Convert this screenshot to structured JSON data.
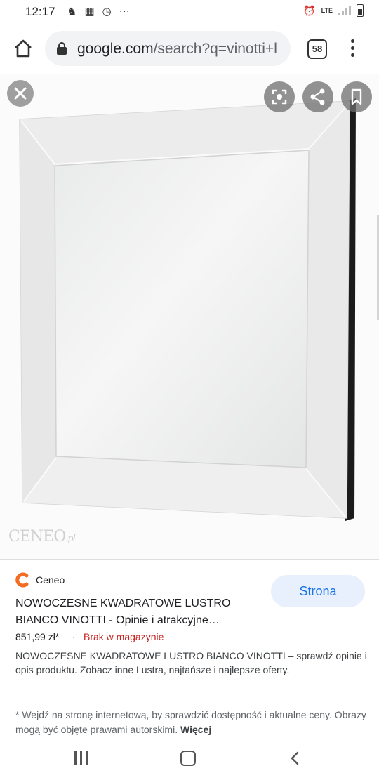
{
  "status_bar": {
    "time": "12:17",
    "network": "LTE"
  },
  "browser": {
    "url_host": "google.com",
    "url_path": "/search?q=vinotti+l",
    "tab_count": "58"
  },
  "image_viewer": {
    "watermark_brand": "CENEO",
    "watermark_suffix": ".pl"
  },
  "result": {
    "source_name": "Ceneo",
    "visit_button": "Strona",
    "title_line1": "NOWOCZESNE KWADRATOWE LUSTRO",
    "title_line2": "BIANCO VINOTTI - Opinie i atrakcyjne…",
    "price": "851,99 zł*",
    "stock_separator": "·",
    "stock_status": "Brak w magazynie",
    "description": "NOWOCZESNE KWADRATOWE LUSTRO BIANCO VINOTTI – sprawdź opinie i opis produktu. Zobacz inne Lustra, najtańsze i najlepsze oferty.",
    "note_text": "* Wejdź na stronę internetową, by sprawdzić dostępność i aktualne ceny. Obrazy mogą być objęte prawami autorskimi.",
    "note_more": "Więcej"
  },
  "colors": {
    "link_blue": "#1a73e8",
    "out_of_stock_red": "#c5221f",
    "ceneo_orange": "#f26d21"
  }
}
